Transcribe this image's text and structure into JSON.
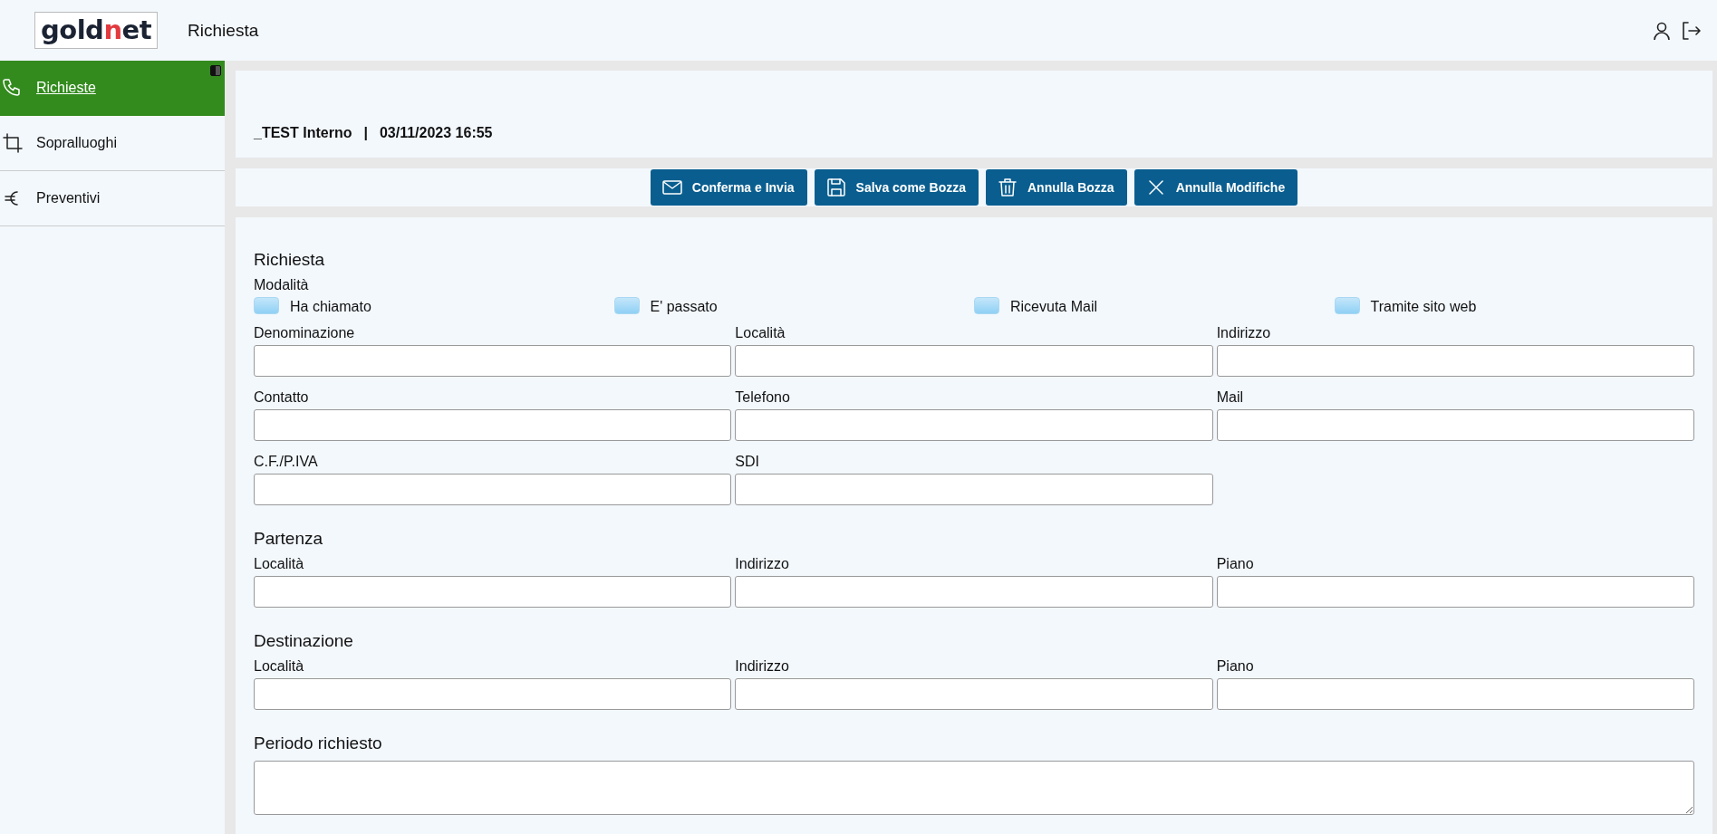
{
  "header": {
    "logo": [
      {
        "text": "gold",
        "accent": false
      },
      {
        "text": "n",
        "accent": true
      },
      {
        "text": "et",
        "accent": false
      }
    ],
    "title": "Richiesta"
  },
  "sidebar": {
    "items": [
      {
        "label": "Richieste",
        "kind": "phone",
        "selected": true
      },
      {
        "label": "Sopralluoghi",
        "kind": "crop",
        "selected": false
      },
      {
        "label": "Preventivi",
        "kind": "euro",
        "selected": false
      }
    ]
  },
  "record": {
    "name": "_TEST Interno",
    "separator": "|",
    "date": "03/11/2023 16:55"
  },
  "toolbar": {
    "buttons": [
      {
        "label": "Conferma e Invia",
        "kind": "mail"
      },
      {
        "label": "Salva come Bozza",
        "kind": "save"
      },
      {
        "label": "Annulla Bozza",
        "kind": "trash"
      },
      {
        "label": "Annulla Modifiche",
        "kind": "close"
      }
    ]
  },
  "form": {
    "sections": [
      {
        "title": "Richiesta",
        "modality": {
          "label": "Modalità",
          "options": [
            {
              "label": "Ha chiamato",
              "checked": false
            },
            {
              "label": "E' passato",
              "checked": false
            },
            {
              "label": "Ricevuta Mail",
              "checked": false
            },
            {
              "label": "Tramite sito web",
              "checked": false
            }
          ]
        },
        "fields": [
          {
            "label": "Denominazione",
            "kind": "input"
          },
          {
            "label": "Località",
            "kind": "input"
          },
          {
            "label": "Indirizzo",
            "kind": "input"
          },
          {
            "label": "Contatto",
            "kind": "input"
          },
          {
            "label": "Telefono",
            "kind": "input"
          },
          {
            "label": "Mail",
            "kind": "input"
          },
          {
            "label": "C.F./P.IVA",
            "kind": "input"
          },
          {
            "label": "SDI",
            "kind": "input"
          }
        ]
      },
      {
        "title": "Partenza",
        "fields": [
          {
            "label": "Località",
            "kind": "input"
          },
          {
            "label": "Indirizzo",
            "kind": "input"
          },
          {
            "label": "Piano",
            "kind": "input"
          }
        ]
      },
      {
        "title": "Destinazione",
        "fields": [
          {
            "label": "Località",
            "kind": "input"
          },
          {
            "label": "Indirizzo",
            "kind": "input"
          },
          {
            "label": "Piano",
            "kind": "input"
          }
        ]
      },
      {
        "title": "Periodo richiesto",
        "fields": [
          {
            "kind": "textarea"
          }
        ]
      }
    ]
  }
}
